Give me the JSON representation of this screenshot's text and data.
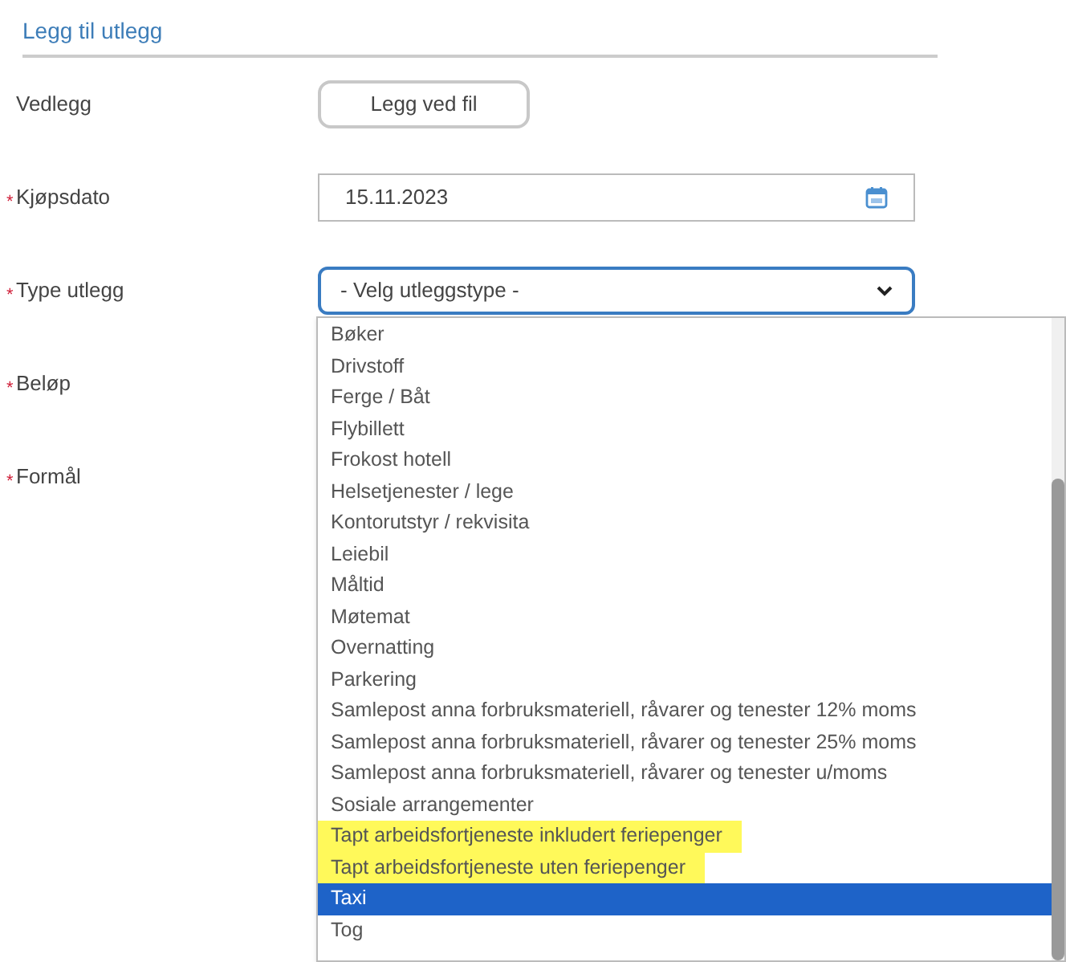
{
  "section_title": "Legg til utlegg",
  "fields": [
    {
      "label": "Vedlegg",
      "kind": "button",
      "button": "Legg ved fil"
    },
    {
      "required_mark": "*",
      "label": "Kjøpsdato",
      "kind": "date",
      "value": "15.11.2023"
    },
    {
      "required_mark": "*",
      "label": "Type utlegg",
      "kind": "select",
      "value": "- Velg utleggstype -"
    },
    {
      "required_mark": "*",
      "label": "Beløp",
      "kind": "empty"
    },
    {
      "required_mark": "*",
      "label": "Formål",
      "kind": "empty"
    }
  ],
  "dropdown_options": [
    {
      "label": "Bøker",
      "selected": false,
      "highlighted": false
    },
    {
      "label": "Drivstoff",
      "selected": false,
      "highlighted": false
    },
    {
      "label": "Ferge / Båt",
      "selected": false,
      "highlighted": false
    },
    {
      "label": "Flybillett",
      "selected": false,
      "highlighted": false
    },
    {
      "label": "Frokost hotell",
      "selected": false,
      "highlighted": false
    },
    {
      "label": "Helsetjenester / lege",
      "selected": false,
      "highlighted": false
    },
    {
      "label": "Kontorutstyr / rekvisita",
      "selected": false,
      "highlighted": false
    },
    {
      "label": "Leiebil",
      "selected": false,
      "highlighted": false
    },
    {
      "label": "Måltid",
      "selected": false,
      "highlighted": false
    },
    {
      "label": "Møtemat",
      "selected": false,
      "highlighted": false
    },
    {
      "label": "Overnatting",
      "selected": false,
      "highlighted": false
    },
    {
      "label": "Parkering",
      "selected": false,
      "highlighted": false
    },
    {
      "label": "Samlepost anna forbruksmateriell, råvarer og tenester 12% moms",
      "selected": false,
      "highlighted": false
    },
    {
      "label": "Samlepost anna forbruksmateriell, råvarer og tenester 25% moms",
      "selected": false,
      "highlighted": false
    },
    {
      "label": "Samlepost anna forbruksmateriell, råvarer og tenester u/moms",
      "selected": false,
      "highlighted": false
    },
    {
      "label": "Sosiale arrangementer",
      "selected": false,
      "highlighted": false
    },
    {
      "label": "Tapt arbeidsfortjeneste inkludert feriepenger",
      "selected": false,
      "highlighted": true
    },
    {
      "label": "Tapt arbeidsfortjeneste uten feriepenger",
      "selected": false,
      "highlighted": true
    },
    {
      "label": "Taxi",
      "selected": true,
      "highlighted": false
    },
    {
      "label": "Tog",
      "selected": false,
      "highlighted": false
    }
  ]
}
